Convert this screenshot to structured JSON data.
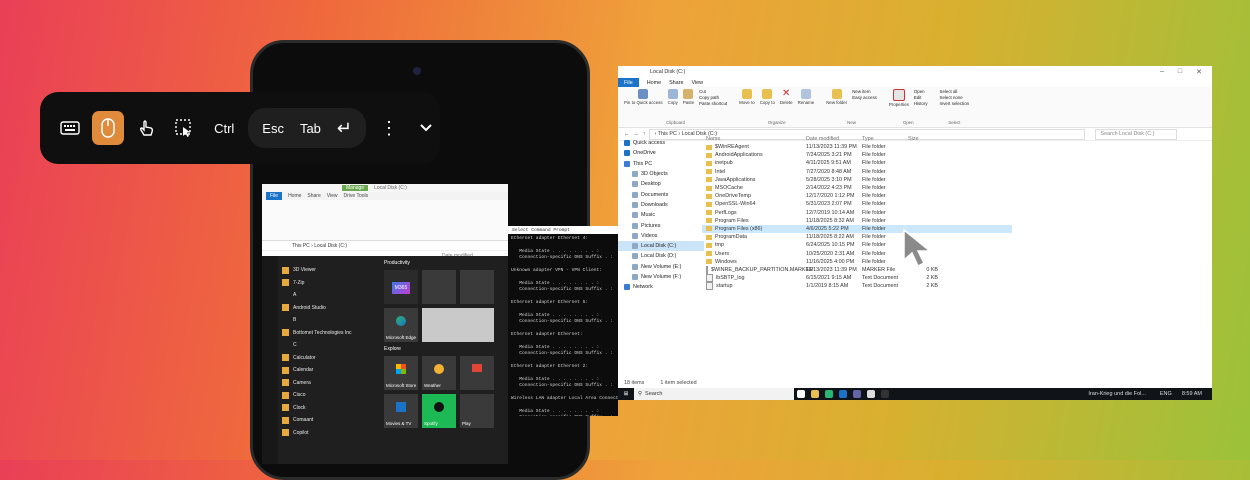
{
  "toolbar": {
    "buttons": [
      "keyboard",
      "mouse",
      "touch",
      "select-area"
    ],
    "ctrl": "Ctrl",
    "esc": "Esc",
    "tab": "Tab",
    "enter": "↵"
  },
  "mini_explorer": {
    "tabs": [
      "File",
      "Home",
      "Share",
      "View",
      "Drive Tools"
    ],
    "manage": "Manage",
    "title": "Local Disk (C:)",
    "address": "This PC › Local Disk (C:)",
    "date_col": "Date modified"
  },
  "start_menu": {
    "apps": [
      "3D Viewer",
      "7-Zip",
      "A",
      "Android Studio",
      "B",
      "Bottomet Technologies Inc",
      "C",
      "Calculator",
      "Calendar",
      "Camera",
      "Cisco",
      "Clock",
      "Comaant",
      "Copilot"
    ],
    "productivity": "Productivity",
    "explore": "Explore",
    "tiles": [
      "M365",
      "Microsoft Edge",
      "Microsoft Store",
      "Weather",
      "Movies & TV",
      "Spotify",
      "Play"
    ]
  },
  "cmd": {
    "title": "Select Command Prompt",
    "lines": [
      "Ethernet adapter Ethernet 4:",
      "",
      "   Media State . . . . . . . . :",
      "   Connection-specific DNS Suffix . :",
      "",
      "Unknown adapter VPN - VPN Client:",
      "",
      "   Media State . . . . . . . . :",
      "   Connection-specific DNS Suffix . :",
      "",
      "Ethernet adapter Ethernet 5:",
      "",
      "   Media State . . . . . . . . :",
      "   Connection-specific DNS Suffix . :",
      "",
      "Ethernet adapter Ethernet:",
      "",
      "   Media State . . . . . . . . :",
      "   Connection-specific DNS Suffix . :",
      "",
      "Ethernet adapter Ethernet 2:",
      "",
      "   Media State . . . . . . . . :",
      "   Connection-specific DNS Suffix . :",
      "",
      "Wireless LAN adapter Local Area Connection:",
      "",
      "   Media State . . . . . . . . :",
      "   Connection-specific DNS Suffix . :"
    ]
  },
  "explorer": {
    "title": "Local Disk (C:)",
    "tabs": [
      "File",
      "Home",
      "Share",
      "View"
    ],
    "ribbon": {
      "clipboard": {
        "label": "Clipboard",
        "items": [
          "Pin to Quick access",
          "Copy",
          "Paste",
          "Cut",
          "Copy path",
          "Paste shortcut"
        ]
      },
      "organize": {
        "label": "Organize",
        "items": [
          "Move to",
          "Copy to",
          "Delete",
          "Rename"
        ]
      },
      "new": {
        "label": "New",
        "items": [
          "New folder",
          "New item",
          "Easy access"
        ]
      },
      "open": {
        "label": "Open",
        "items": [
          "Properties",
          "Open",
          "Edit",
          "History"
        ]
      },
      "select": {
        "label": "Select",
        "items": [
          "Select all",
          "Select none",
          "Invert selection"
        ]
      }
    },
    "address": "› This PC › Local Disk (C:)",
    "search_placeholder": "Search Local Disk (C:)",
    "nav": [
      "Quick access",
      "OneDrive",
      "This PC",
      "3D Objects",
      "Desktop",
      "Documents",
      "Downloads",
      "Music",
      "Pictures",
      "Videos",
      "Local Disk (C:)",
      "Local Disk (D:)",
      "New Volume (E:)",
      "New Volume (F:)",
      "Network"
    ],
    "columns": [
      "Name",
      "Date modified",
      "Type",
      "Size"
    ],
    "rows": [
      {
        "name": "$WinREAgent",
        "date": "11/13/2023 11:39 PM",
        "type": "File folder",
        "size": "",
        "kind": "folder"
      },
      {
        "name": "AndroidApplications",
        "date": "7/24/2025 3:21 PM",
        "type": "File folder",
        "size": "",
        "kind": "folder"
      },
      {
        "name": "inetpub",
        "date": "4/11/2025 9:51 AM",
        "type": "File folder",
        "size": "",
        "kind": "folder"
      },
      {
        "name": "Intel",
        "date": "7/27/2020 8:48 AM",
        "type": "File folder",
        "size": "",
        "kind": "folder"
      },
      {
        "name": "JavaApplications",
        "date": "5/28/2025 3:10 PM",
        "type": "File folder",
        "size": "",
        "kind": "folder"
      },
      {
        "name": "MSOCache",
        "date": "2/14/2022 4:23 PM",
        "type": "File folder",
        "size": "",
        "kind": "folder"
      },
      {
        "name": "OneDriveTemp",
        "date": "12/17/2020 1:12 PM",
        "type": "File folder",
        "size": "",
        "kind": "folder"
      },
      {
        "name": "OpenSSL-Win64",
        "date": "5/31/2023 2:07 PM",
        "type": "File folder",
        "size": "",
        "kind": "folder"
      },
      {
        "name": "PerfLogs",
        "date": "12/7/2019 10:14 AM",
        "type": "File folder",
        "size": "",
        "kind": "folder"
      },
      {
        "name": "Program Files",
        "date": "11/18/2025 8:32 AM",
        "type": "File folder",
        "size": "",
        "kind": "folder"
      },
      {
        "name": "Program Files (x86)",
        "date": "4/6/2025 5:22 PM",
        "type": "File folder",
        "size": "",
        "kind": "folder",
        "highlight": true
      },
      {
        "name": "ProgramData",
        "date": "11/18/2025 8:22 AM",
        "type": "File folder",
        "size": "",
        "kind": "folder"
      },
      {
        "name": "tmp",
        "date": "6/24/2025 10:15 PM",
        "type": "File folder",
        "size": "",
        "kind": "folder"
      },
      {
        "name": "Users",
        "date": "10/25/2020 2:31 AM",
        "type": "File folder",
        "size": "",
        "kind": "folder"
      },
      {
        "name": "Windows",
        "date": "11/16/2025 4:00 PM",
        "type": "File folder",
        "size": "",
        "kind": "folder"
      },
      {
        "name": "$WINRE_BACKUP_PARTITION.MARKER",
        "date": "11/13/2023 11:39 PM",
        "type": "MARKER File",
        "size": "0 KB",
        "kind": "file"
      },
      {
        "name": "lbSBTP_log",
        "date": "6/15/2021 9:15 AM",
        "type": "Text Document",
        "size": "2 KB",
        "kind": "file"
      },
      {
        "name": "startup",
        "date": "1/1/2019 8:15 AM",
        "type": "Text Document",
        "size": "2 KB",
        "kind": "file"
      }
    ],
    "status_items": "18 items",
    "status_selected": "1 item selected"
  },
  "taskbar": {
    "search": "Search",
    "news": "Iran-Krieg und die Fol...",
    "lang": "ENG",
    "time": "8:59 AM"
  },
  "colors": {
    "accent": "#1a73c8",
    "toolbar_active": "#e08a3c"
  }
}
